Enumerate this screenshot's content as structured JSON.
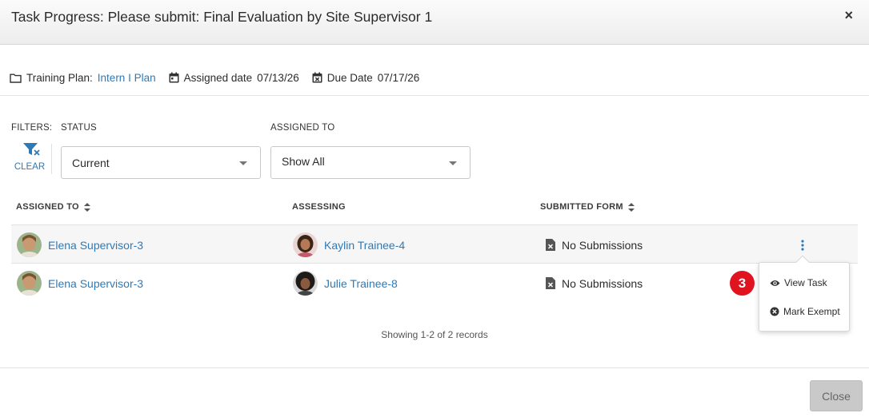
{
  "dialog": {
    "title": "Task Progress: Please submit: Final Evaluation by Site Supervisor 1",
    "close_icon": "×"
  },
  "meta": {
    "training_plan_label": "Training Plan:",
    "training_plan_value": "Intern I Plan",
    "assigned_date_label": "Assigned date",
    "assigned_date_value": "07/13/26",
    "due_date_label": "Due Date",
    "due_date_value": "07/17/26"
  },
  "filters": {
    "label": "FILTERS:",
    "clear_label": "CLEAR",
    "status_label": "STATUS",
    "status_value": "Current",
    "assigned_to_label": "ASSIGNED TO",
    "assigned_to_value": "Show All"
  },
  "table": {
    "columns": [
      "ASSIGNED TO",
      "ASSESSING",
      "SUBMITTED FORM"
    ],
    "rows": [
      {
        "assigned_to": "Elena Supervisor-3",
        "assessing": "Kaylin Trainee-4",
        "submitted_form": "No Submissions"
      },
      {
        "assigned_to": "Elena Supervisor-3",
        "assessing": "Julie Trainee-8",
        "submitted_form": "No Submissions"
      }
    ]
  },
  "row_menu": {
    "items": [
      {
        "label": "View Task",
        "icon": "eye-icon"
      },
      {
        "label": "Mark Exempt",
        "icon": "x-circle-icon"
      }
    ]
  },
  "step_badge": "3",
  "records_text": "Showing 1-2 of 2 records",
  "footer": {
    "close_label": "Close"
  },
  "colors": {
    "link": "#2d7ab9",
    "badge": "#e0141e",
    "header_bg": "#f3f3f3",
    "row_highlight": "#f6f6f6"
  }
}
